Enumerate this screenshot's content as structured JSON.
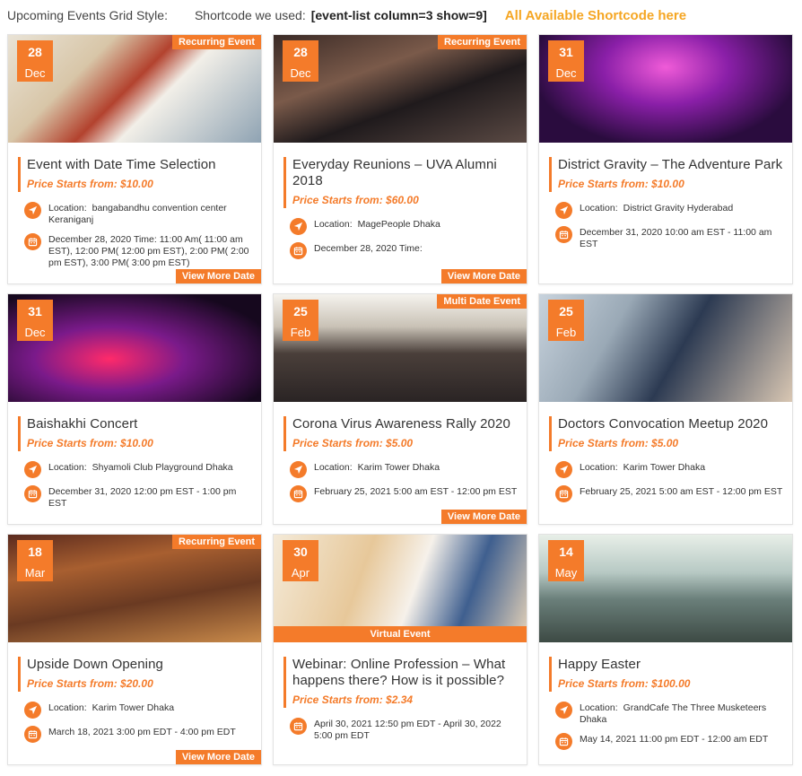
{
  "header": {
    "grid_title": "Upcoming Events Grid Style:",
    "shortcode_label": "Shortcode we used:",
    "shortcode": "[event-list column=3 show=9]",
    "all_link": "All Available Shortcode here"
  },
  "colors": {
    "accent": "#f47b2a",
    "link": "#f5a623"
  },
  "events": [
    {
      "day": "28",
      "month": "Dec",
      "ribbon": "Recurring Event",
      "title": "Event with Date Time Selection",
      "price": "Price Starts from: $10.00",
      "location_label": "Location:",
      "location": "bangabandhu convention center Keraniganj",
      "datetime": "December 28, 2020 Time:  11:00 Am( 11:00 am EST), 12:00 PM( 12:00 pm EST), 2:00 PM( 2:00 pm EST), 3:00 PM( 3:00 pm EST)",
      "more": "View More Date",
      "thumb_icon": "classroom-photo"
    },
    {
      "day": "28",
      "month": "Dec",
      "ribbon": "Recurring Event",
      "title": "Everyday Reunions – UVA Alumni 2018",
      "price": "Price Starts from: $60.00",
      "location_label": "Location:",
      "location": "MagePeople Dhaka",
      "datetime": "December 28, 2020 Time:",
      "more": "View More Date",
      "thumb_icon": "audience-photo"
    },
    {
      "day": "31",
      "month": "Dec",
      "ribbon": "",
      "title": "District Gravity – The Adventure Park",
      "price": "Price Starts from: $10.00",
      "location_label": "Location:",
      "location": "District Gravity Hyderabad",
      "datetime": "December 31, 2020  10:00 am EST - 11:00 am EST",
      "more": "",
      "thumb_icon": "banquet-photo"
    },
    {
      "day": "31",
      "month": "Dec",
      "ribbon": "",
      "title": "Baishakhi Concert",
      "price": "Price Starts from: $10.00",
      "location_label": "Location:",
      "location": "Shyamoli Club Playground Dhaka",
      "datetime": "December 31, 2020  12:00 pm EST - 1:00 pm EST",
      "more": "",
      "thumb_icon": "arena-photo"
    },
    {
      "day": "25",
      "month": "Feb",
      "ribbon": "Multi Date Event",
      "title": "Corona Virus Awareness Rally 2020",
      "price": "Price Starts from: $5.00",
      "location_label": "Location:",
      "location": "Karim Tower Dhaka",
      "datetime": "February 25, 2021  5:00 am EST - 12:00 pm EST",
      "more": "View More Date",
      "thumb_icon": "conference-photo"
    },
    {
      "day": "25",
      "month": "Feb",
      "ribbon": "",
      "title": "Doctors Convocation Meetup 2020",
      "price": "Price Starts from: $5.00",
      "location_label": "Location:",
      "location": "Karim Tower Dhaka",
      "datetime": "February 25, 2021  5:00 am EST - 12:00 pm EST",
      "more": "",
      "thumb_icon": "business-people-photo"
    },
    {
      "day": "18",
      "month": "Mar",
      "ribbon": "Recurring Event",
      "title": "Upside Down Opening",
      "price": "Price Starts from: $20.00",
      "location_label": "Location:",
      "location": "Karim Tower Dhaka",
      "datetime": "March 18, 2021  3:00 pm EDT - 4:00 pm EDT",
      "more": "View More Date",
      "thumb_icon": "auditorium-photo"
    },
    {
      "day": "30",
      "month": "Apr",
      "ribbon": "",
      "virtual": "Virtual Event",
      "title": "Webinar: Online Profession – What happens there? How is it possible?",
      "price": "Price Starts from: $2.34",
      "location_label": "",
      "location": "",
      "datetime": "April 30, 2021  12:50 pm EDT - April 30, 2022 5:00 pm EDT",
      "more": "",
      "thumb_icon": "speaker-photo"
    },
    {
      "day": "14",
      "month": "May",
      "ribbon": "",
      "title": "Happy Easter",
      "price": "Price Starts from: $100.00",
      "location_label": "Location:",
      "location": "GrandCafe The Three Musketeers Dhaka",
      "datetime": "May 14, 2021  11:00 pm EDT - 12:00 am EDT",
      "more": "",
      "thumb_icon": "seminar-photo"
    }
  ]
}
